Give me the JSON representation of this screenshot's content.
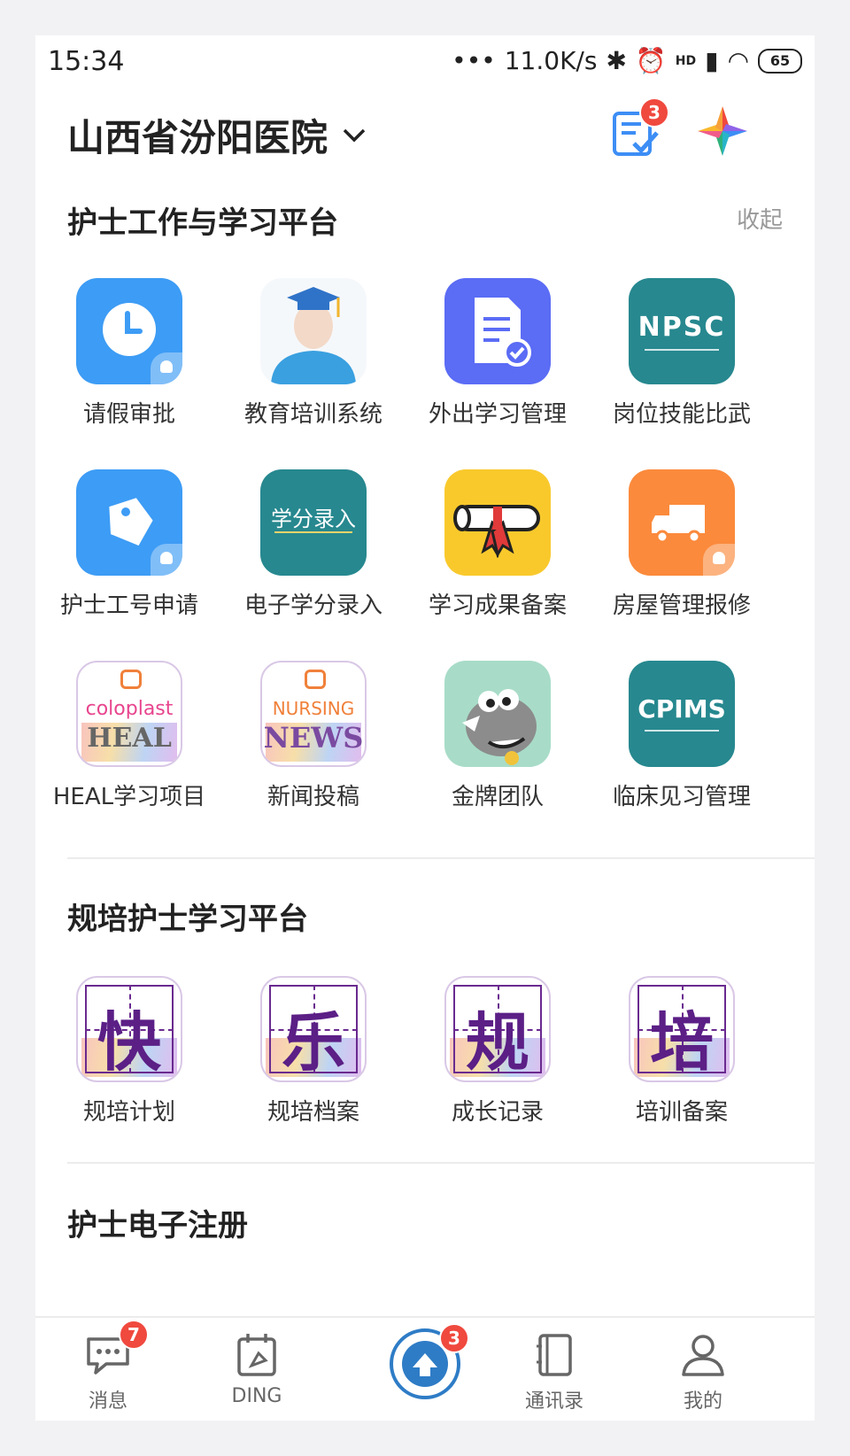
{
  "status": {
    "time": "15:34",
    "network": "11.0K/s",
    "hd": "HD",
    "battery": "65"
  },
  "header": {
    "org_name": "山西省汾阳医院",
    "tasks_badge": "3"
  },
  "section1": {
    "title": "护士工作与学习平台",
    "collapse_label": "收起",
    "apps": [
      {
        "label": "请假审批",
        "icon": "clock-icon"
      },
      {
        "label": "教育培训系统",
        "icon": "graduate-icon"
      },
      {
        "label": "外出学习管理",
        "icon": "document-check-icon"
      },
      {
        "label": "岗位技能比武",
        "icon": "npsc-logo",
        "tile_text": "NPSC"
      },
      {
        "label": "护士工号申请",
        "icon": "tag-icon"
      },
      {
        "label": "电子学分录入",
        "icon": "credit-entry-logo",
        "tile_text": "学分录入"
      },
      {
        "label": "学习成果备案",
        "icon": "diploma-icon"
      },
      {
        "label": "房屋管理报修",
        "icon": "truck-icon"
      },
      {
        "label": "HEAL学习项目",
        "icon": "heal-logo",
        "tile_text_top": "coloplast",
        "tile_text_bottom": "HEAL"
      },
      {
        "label": "新闻投稿",
        "icon": "nursing-news-logo",
        "tile_text_top": "NURSING",
        "tile_text_bottom": "NEWS"
      },
      {
        "label": "金牌团队",
        "icon": "rhino-mascot-icon"
      },
      {
        "label": "临床见习管理",
        "icon": "cpims-logo",
        "tile_text": "CPIMS"
      }
    ]
  },
  "section2": {
    "title": "规培护士学习平台",
    "apps": [
      {
        "label": "规培计划",
        "char": "快"
      },
      {
        "label": "规培档案",
        "char": "乐"
      },
      {
        "label": "成长记录",
        "char": "规"
      },
      {
        "label": "培训备案",
        "char": "培"
      }
    ]
  },
  "section3": {
    "title": "护士电子注册"
  },
  "tabbar": {
    "items": [
      {
        "label": "消息",
        "icon": "chat-icon",
        "badge": "7"
      },
      {
        "label": "DING",
        "icon": "ding-icon"
      },
      {
        "label": "",
        "icon": "hospital-logo-icon",
        "badge": "3"
      },
      {
        "label": "通讯录",
        "icon": "contacts-icon"
      },
      {
        "label": "我的",
        "icon": "person-icon"
      }
    ]
  },
  "colors": {
    "blue": "#3d9cf5",
    "teal": "#27888f",
    "indigo": "#5b6cf5",
    "yellow": "#f9c92c",
    "orange": "#fb8a3c",
    "badge_red": "#f0493e",
    "calligraphy_purple": "#5b1f86"
  }
}
